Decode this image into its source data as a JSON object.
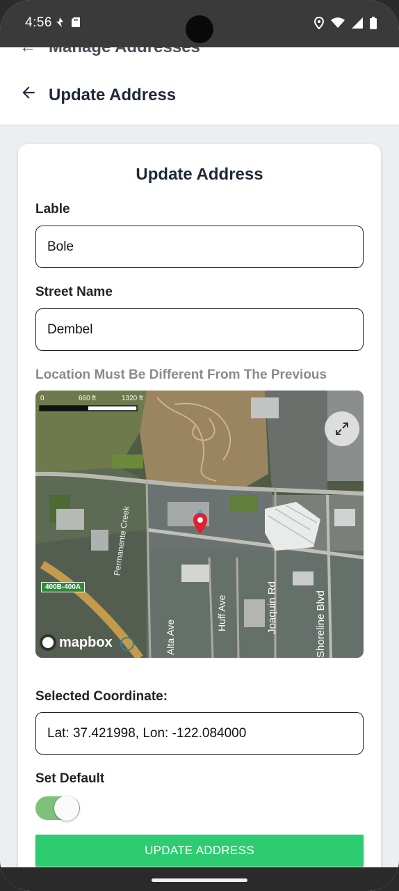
{
  "status_bar": {
    "time": "4:56",
    "left_icons": [
      "navigation-icon",
      "sd-card-icon"
    ],
    "right_icons": [
      "location-icon",
      "wifi-icon",
      "signal-icon",
      "battery-icon"
    ]
  },
  "previous_header": {
    "title": "Manage Addresses"
  },
  "app_bar": {
    "title": "Update Address",
    "back_icon": "arrow-left-icon"
  },
  "form": {
    "title": "Update Address",
    "label_field": {
      "label": "Lable",
      "value": "Bole"
    },
    "street_field": {
      "label": "Street Name",
      "value": "Dembel"
    },
    "location_hint": "Location Must Be Different From The Previous",
    "map": {
      "scale_labels": [
        "0",
        "660 ft",
        "1320 ft"
      ],
      "road_labels": [
        "Permanente Creek",
        "Alta Ave",
        "Huff Ave",
        "Joaquin Rd",
        "Shoreline Blvd",
        "400B-400A"
      ],
      "attribution": "mapbox",
      "fullscreen_icon": "expand-icon",
      "marker_icon": "map-pin-icon"
    },
    "coordinate": {
      "label": "Selected Coordinate:",
      "value": "Lat: 37.421998, Lon: -122.084000"
    },
    "default": {
      "label": "Set Default",
      "enabled": true
    },
    "submit_label": "UPDATE ADDRESS"
  },
  "colors": {
    "accent": "#2ecc71",
    "toggle_track": "#7ec27a",
    "marker": "#e0202f"
  }
}
